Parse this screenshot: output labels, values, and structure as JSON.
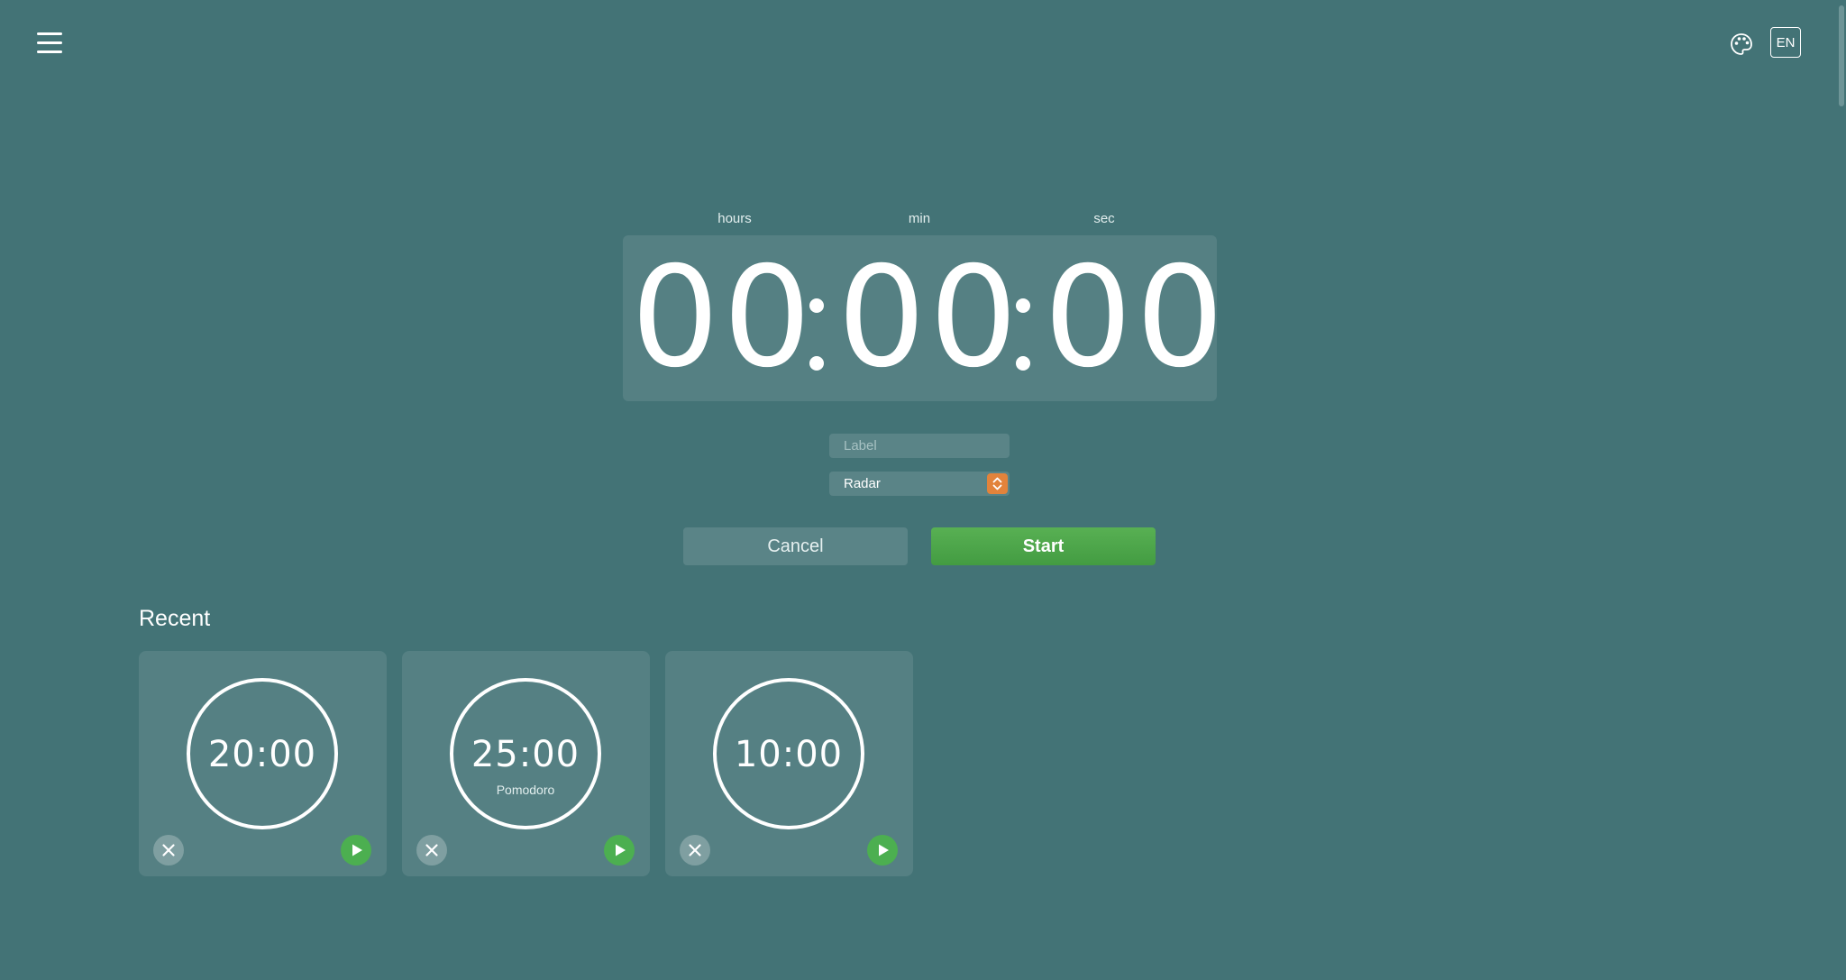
{
  "header": {
    "menu_icon": "hamburger-menu-icon",
    "theme_icon": "palette-icon",
    "language": "EN"
  },
  "timer": {
    "units": {
      "hours": "hours",
      "min": "min",
      "sec": "sec"
    },
    "hours": "00",
    "minutes": "00",
    "seconds": "00"
  },
  "form": {
    "label_placeholder": "Label",
    "label_value": "",
    "sound_selected": "Radar"
  },
  "actions": {
    "cancel": "Cancel",
    "start": "Start"
  },
  "recent": {
    "heading": "Recent",
    "items": [
      {
        "time": "20:00",
        "label": ""
      },
      {
        "time": "25:00",
        "label": "Pomodoro"
      },
      {
        "time": "10:00",
        "label": ""
      }
    ]
  },
  "colors": {
    "background": "#437376",
    "panel": "#558083",
    "start_green": "#4caf50",
    "select_accent": "#e2833b"
  }
}
